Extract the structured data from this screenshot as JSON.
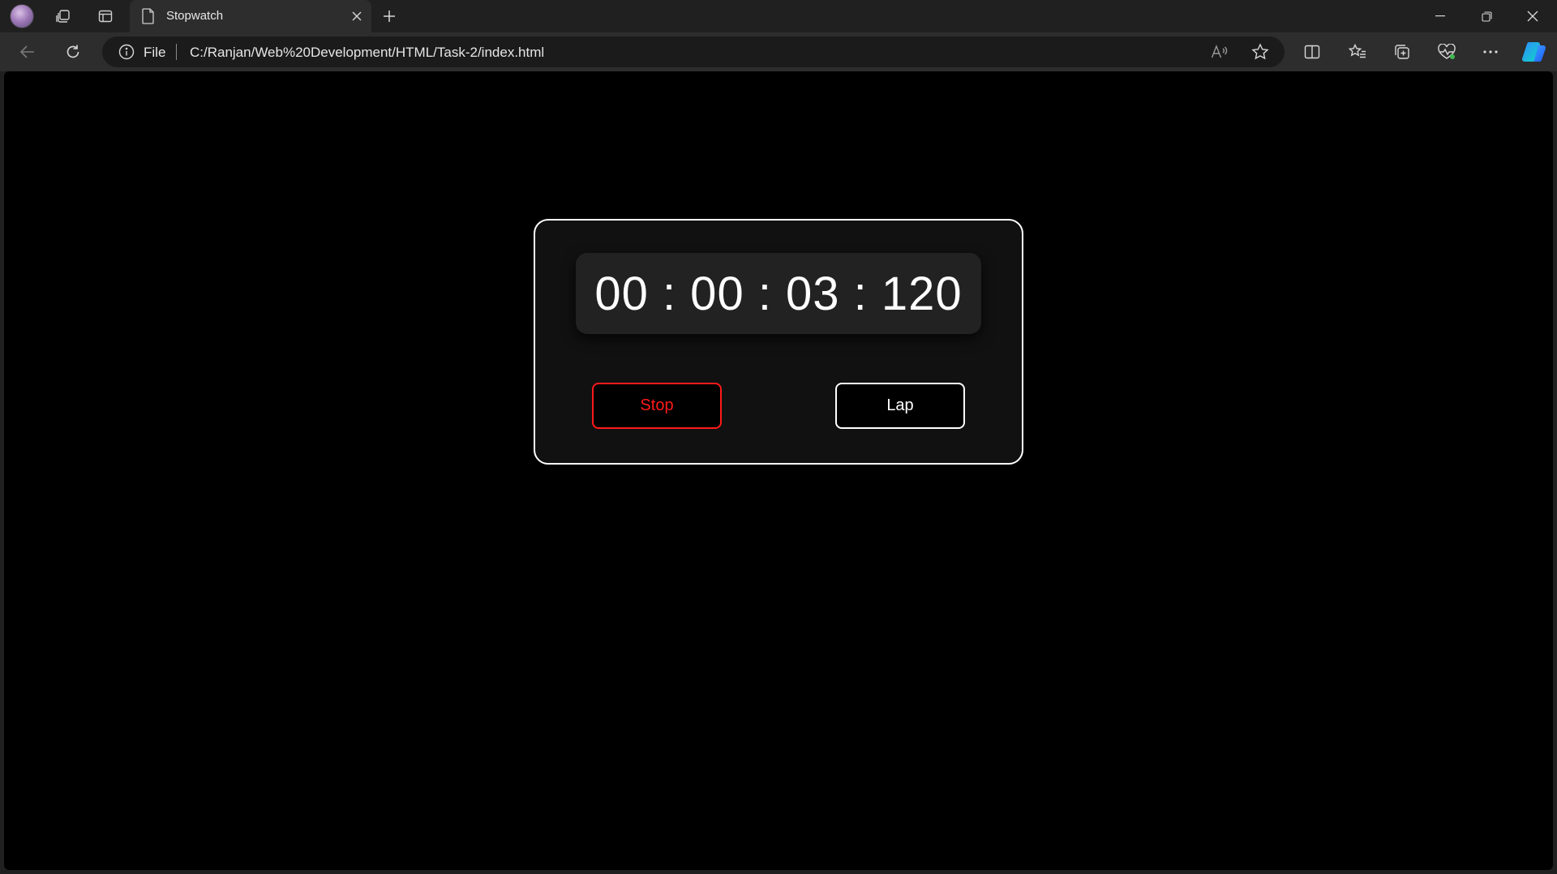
{
  "browser": {
    "tab": {
      "title": "Stopwatch"
    },
    "address": {
      "scheme_label": "File",
      "url": "C:/Ranjan/Web%20Development/HTML/Task-2/index.html"
    },
    "icons": {
      "profile": "avatar",
      "workspaces": "workspaces-icon",
      "vertical_tabs": "vertical-tabs-icon",
      "page": "page-icon",
      "close_tab": "close-icon",
      "new_tab": "plus-icon",
      "minimize": "minimize-icon",
      "restore": "restore-icon",
      "close_window": "close-icon",
      "back": "back-arrow-icon",
      "refresh": "refresh-icon",
      "site_info": "info-icon",
      "read_aloud": "read-aloud-icon",
      "favorite": "star-icon",
      "split_screen": "split-screen-icon",
      "favorites": "favorites-icon",
      "collections": "collections-icon",
      "performance": "heartbeat-icon",
      "more": "more-icon",
      "copilot": "copilot-icon"
    }
  },
  "stopwatch": {
    "time": "00 : 00 : 03 : 120",
    "stop_label": "Stop",
    "lap_label": "Lap"
  },
  "colors": {
    "page_bg": "#000000",
    "card_bg": "#111111",
    "display_bg": "#222222",
    "stop_accent": "#ff1a1a",
    "text": "#ffffff"
  }
}
